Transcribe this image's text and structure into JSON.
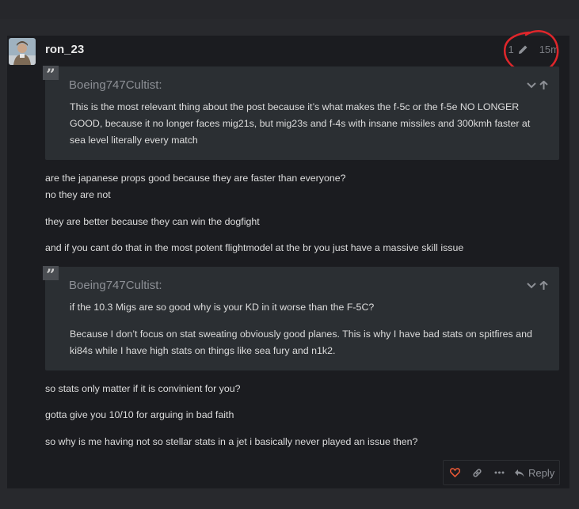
{
  "post": {
    "username": "ron_23",
    "edit_count": "1",
    "time": "15m",
    "quote1": {
      "author": "Boeing747Cultist:",
      "lines": [
        "This is the most relevant thing about the post because it’s what makes the f-5c or the f-5e NO LONGER",
        "GOOD, because it no longer faces mig21s, but mig23s and f-4s with insane missiles and 300kmh faster at",
        "sea level literally every match"
      ]
    },
    "para1": [
      "are the japanese props good because they are faster than everyone?",
      "no they are not"
    ],
    "para2": "they are better because they can win the dogfight",
    "para3": "and if you cant do that in the most potent flightmodel at the br you just have a massive skill issue",
    "quote2": {
      "author": "Boeing747Cultist:",
      "line1": "if the 10.3 Migs are so good why is your KD in it worse than the F-5C?",
      "line2a": "Because I don’t focus on stat sweating obviously good planes. This is why I have bad stats on spitfires and",
      "line2b": "ki84s while I have high stats on things like sea fury and n1k2."
    },
    "para4": "so stats only matter if it is convinient for you?",
    "para5": "gotta give you 10/10 for arguing in bad faith",
    "para6": "so why is me having not so stellar stats in a jet i basically never played an issue then?",
    "actions": {
      "reply_label": "Reply"
    }
  },
  "icons": {
    "like": "heart-icon",
    "link": "link-icon",
    "more": "ellipsis-icon",
    "reply": "reply-icon",
    "edit": "pencil-icon",
    "expand": "chevron-down-icon",
    "go_to_quote": "arrow-up-icon",
    "quote": "quote-icon"
  },
  "colors": {
    "background": "#28292d",
    "post_background": "#1b1c20",
    "quote_background": "#2b2f33",
    "like_accent": "#e45735",
    "annotation": "#e0262b"
  }
}
